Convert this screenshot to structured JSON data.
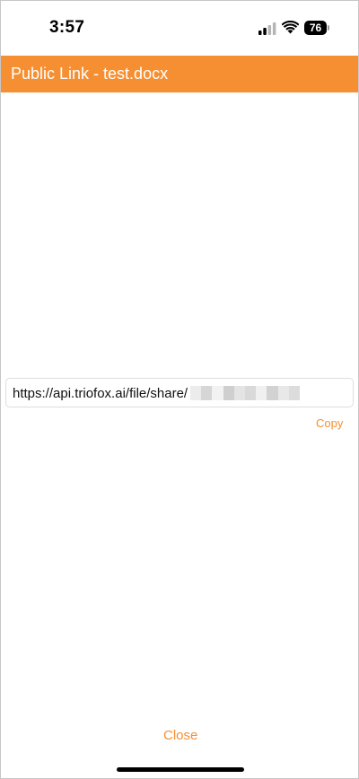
{
  "status_bar": {
    "time": "3:57",
    "battery_level": "76",
    "icons": [
      "signal-icon",
      "wifi-icon",
      "battery-icon"
    ]
  },
  "header": {
    "title": "Public Link - test.docx",
    "background_color": "#f58f32"
  },
  "link": {
    "url_visible": "https://api.triofox.ai/file/share/",
    "redacted": true
  },
  "actions": {
    "copy_label": "Copy",
    "close_label": "Close"
  },
  "colors": {
    "accent": "#f58f32",
    "text": "#111111",
    "background": "#ffffff"
  }
}
